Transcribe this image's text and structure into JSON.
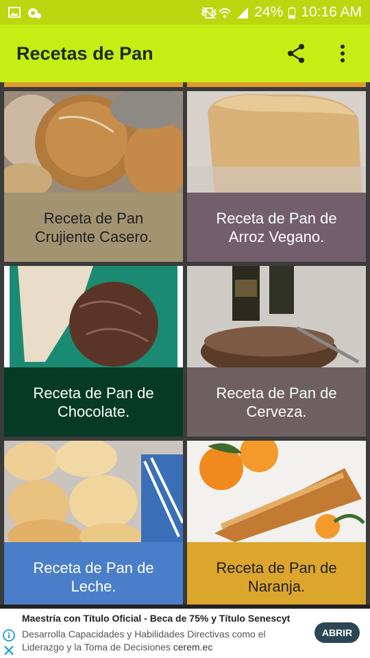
{
  "status_bar": {
    "battery": "24%",
    "time": "10:16 AM",
    "icons": [
      "image-icon",
      "gear-notification-icon",
      "vibrate-icon",
      "wifi-icon",
      "signal-icon",
      "battery-icon"
    ]
  },
  "app_bar": {
    "title": "Recetas de Pan",
    "icons": [
      "share-icon",
      "more-vert-icon"
    ]
  },
  "recipes": [
    {
      "label": "Receta de Pan Crujiente Casero.",
      "label_bg": "#a39371",
      "text_color": "#1f1f1f",
      "image": "rustic-loaves"
    },
    {
      "label": "Receta de Pan de Arroz Vegano.",
      "label_bg": "#735f6c",
      "text_color": "#ffffff",
      "image": "white-loaf"
    },
    {
      "label": "Receta de Pan de Chocolate.",
      "label_bg": "#063a25",
      "text_color": "#ffffff",
      "image": "chocolate-loaf"
    },
    {
      "label": "Receta de Pan de Cerveza.",
      "label_bg": "#6e5f60",
      "text_color": "#ffffff",
      "image": "beer-bread"
    },
    {
      "label": "Receta de Pan de Leche.",
      "label_bg": "#4a7ec9",
      "text_color": "#ffffff",
      "image": "milk-rolls"
    },
    {
      "label": "Receta de Pan de Naranja.",
      "label_bg": "#dca62d",
      "text_color": "#1f1f1f",
      "image": "orange-loaf"
    }
  ],
  "ad": {
    "title": "Maestría con Título Oficial - Beca de 75% y Título Senescyt",
    "description": "Desarrolla Capacidades y Habilidades Directivas como el Liderazgo y la Toma de Decisiones",
    "domain": "cerem.ec",
    "button": "ABRIR"
  },
  "colors": {
    "status_bar": "#b9d80f",
    "app_bar": "#c6ee14",
    "grid_bg": "#3b3b3b"
  }
}
